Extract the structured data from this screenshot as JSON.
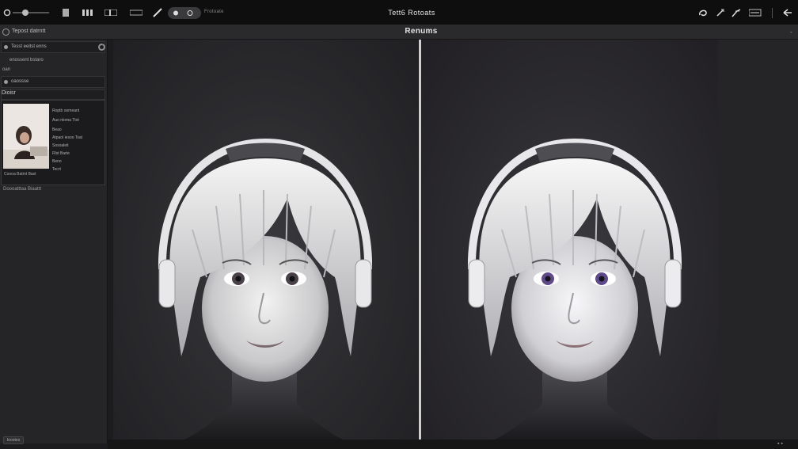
{
  "toolbar": {
    "title": "Tett6 Rotoats",
    "pill_label": "Frotoate",
    "buttons": [
      "circle-icon",
      "slider-icon",
      "grid-icon",
      "film-icon",
      "layout-icon",
      "pen-icon",
      "brush-icon",
      "lasso-icon",
      "arrow-icon",
      "ruler-icon",
      "bar-icon",
      "undo-icon"
    ]
  },
  "panel_header": {
    "left_label": "Tepost datrntt",
    "title": "Renums",
    "collapse": "-"
  },
  "sidebar": {
    "row1_label": "Tesst eeitst enns",
    "row1_sub": "enossent bstaro",
    "row2_label": "oan",
    "row3_label": "oaossse",
    "section_label": "Dioisr",
    "thumb_caption": "Coooa Batmt Bast",
    "meta": [
      "Roptb oomeant",
      "Auo nloma Ttot",
      "Beao",
      "Atpaol iesoo Tsat",
      "Sosoaleit",
      "Rlst Barte",
      "Beno",
      "Tecrt"
    ],
    "footer_note": "Doooatttaa Biaattt",
    "bottom_button": "Ioootes"
  },
  "colors": {
    "background": "#1c1c1e",
    "toolbar": "#0e0e0f",
    "panel": "#252527",
    "divider": "#cfcfcf",
    "iris_left": "#4a4048",
    "iris_right": "#5e4a8a"
  },
  "status": {
    "icons": "▪ ▪"
  }
}
